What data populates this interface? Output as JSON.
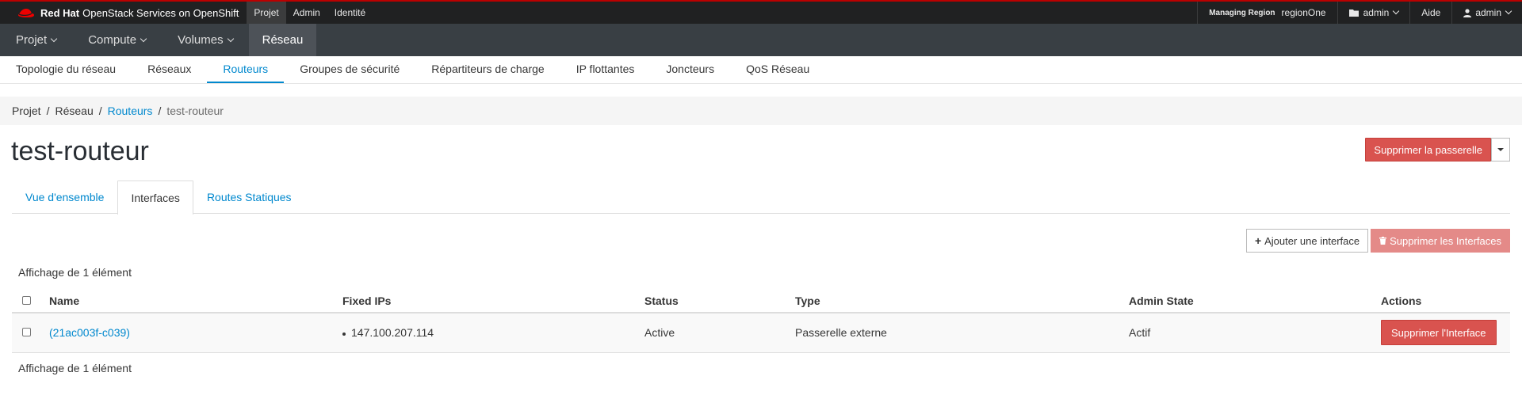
{
  "masthead": {
    "brand_bold": "Red Hat",
    "brand_rest": "OpenStack Services on OpenShift",
    "nav": [
      "Projet",
      "Admin",
      "Identité"
    ],
    "region_label": "Managing Region",
    "region_value": "regionOne",
    "project": "admin",
    "help": "Aide",
    "user": "admin"
  },
  "secnav": [
    "Projet",
    "Compute",
    "Volumes",
    "Réseau"
  ],
  "tertnav": [
    "Topologie du réseau",
    "Réseaux",
    "Routeurs",
    "Groupes de sécurité",
    "Répartiteurs de charge",
    "IP flottantes",
    "Joncteurs",
    "QoS Réseau"
  ],
  "breadcrumb": [
    "Projet",
    "Réseau",
    "Routeurs",
    "test-routeur"
  ],
  "page_title": "test-routeur",
  "delete_gateway_label": "Supprimer la passerelle",
  "tabs": [
    "Vue d'ensemble",
    "Interfaces",
    "Routes Statiques"
  ],
  "add_interface_label": "Ajouter une interface",
  "delete_interfaces_label": "Supprimer les Interfaces",
  "count_text": "Affichage de 1 élément",
  "table": {
    "headers": [
      "Name",
      "Fixed IPs",
      "Status",
      "Type",
      "Admin State",
      "Actions"
    ],
    "rows": [
      {
        "name": "(21ac003f-c039)",
        "ip": "147.100.207.114",
        "status": "Active",
        "type": "Passerelle externe",
        "admin_state": "Actif",
        "action": "Supprimer l'Interface"
      }
    ]
  },
  "colors": {
    "accent": "#0088ce",
    "danger": "#d9534f",
    "masthead": "#202122",
    "secnav": "#393f44"
  }
}
